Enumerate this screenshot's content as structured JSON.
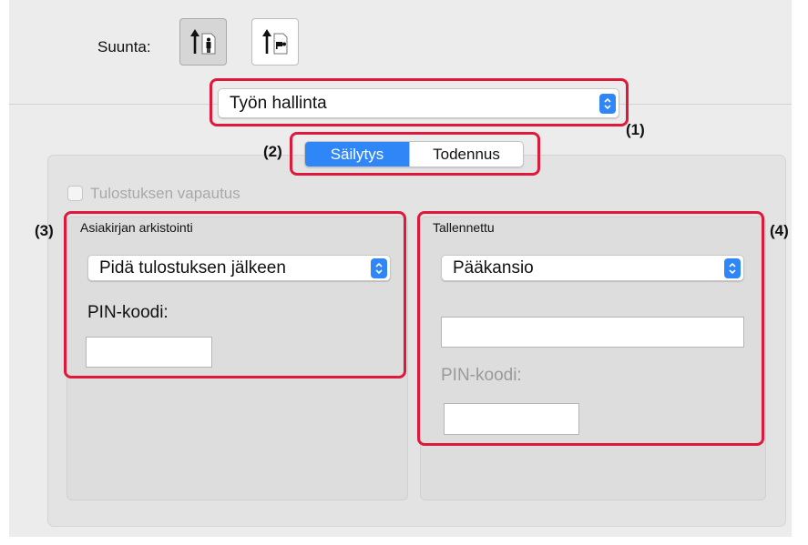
{
  "orientation": {
    "label": "Suunta:",
    "options": [
      {
        "name": "portrait",
        "selected": true
      },
      {
        "name": "landscape",
        "selected": false
      }
    ]
  },
  "job_menu": {
    "value": "Työn hallinta"
  },
  "callouts": {
    "c1": "(1)",
    "c2": "(2)",
    "c3": "(3)",
    "c4": "(4)"
  },
  "tabs": [
    {
      "label": "Säilytys",
      "active": true
    },
    {
      "label": "Todennus",
      "active": false
    }
  ],
  "release": {
    "label": "Tulostuksen vapautus",
    "checked": false,
    "enabled": false
  },
  "archive": {
    "title": "Asiakirjan arkistointi",
    "mode": "Pidä tulostuksen jälkeen",
    "pin_label": "PIN-koodi:",
    "pin_value": ""
  },
  "stored": {
    "title": "Tallennettu",
    "folder": "Pääkansio",
    "name_value": "",
    "pin_label": "PIN-koodi:",
    "pin_value": ""
  },
  "colors": {
    "accent": "#2f86f6",
    "highlight": "#e0193a"
  }
}
